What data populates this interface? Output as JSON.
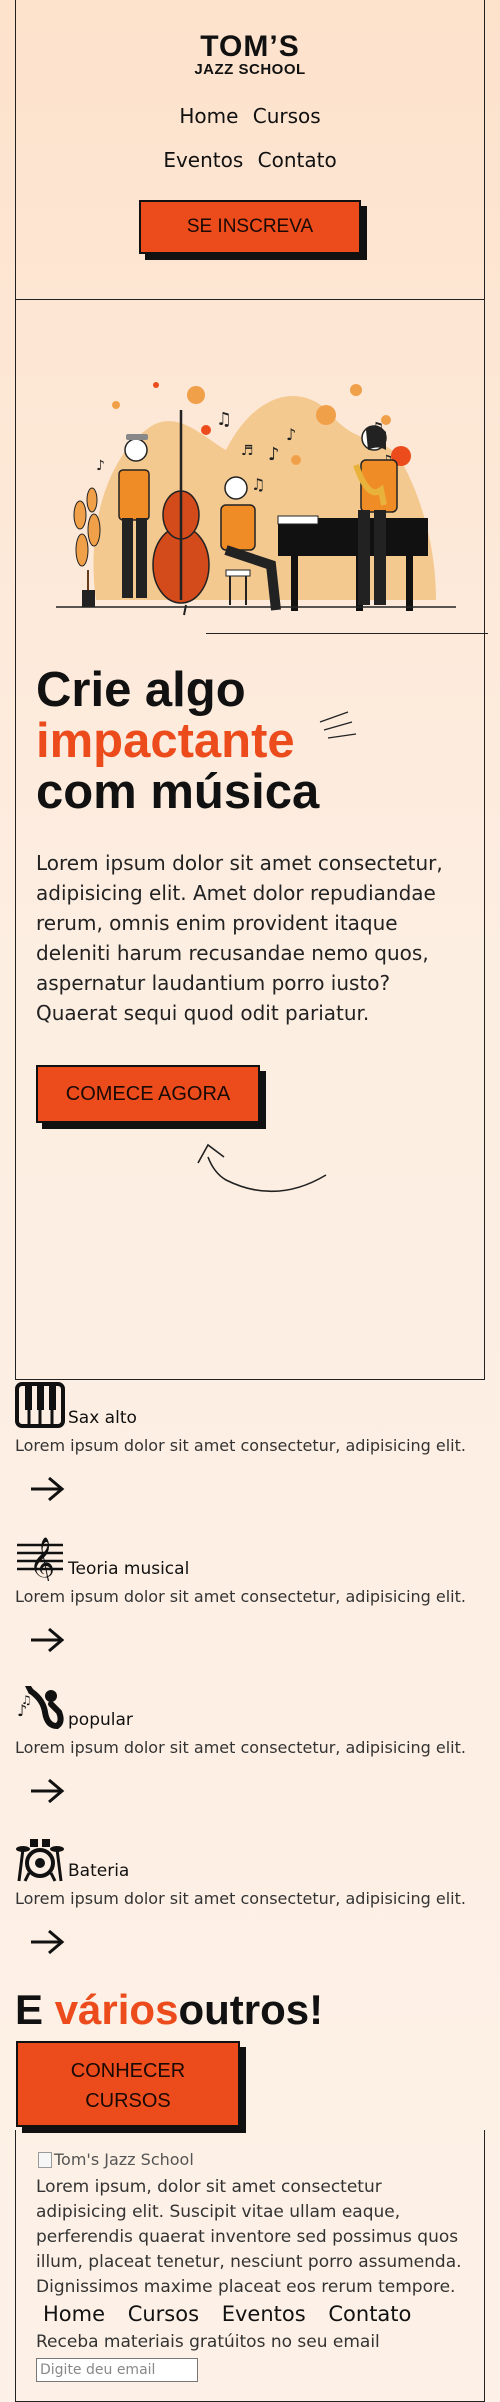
{
  "brand": {
    "name": "TOM’S",
    "sub": "JAZZ SCHOOL"
  },
  "nav": {
    "home": "Home",
    "courses": "Cursos",
    "events": "Eventos",
    "contact": "Contato"
  },
  "header": {
    "subscribe_label": "SE INSCREVA"
  },
  "hero": {
    "title_line1": "Crie algo",
    "title_accent": "impactante",
    "title_line3": "com música",
    "text": "Lorem ipsum dolor sit amet consectetur, adipisicing elit. Amet dolor repudiandae rerum, omnis enim provident itaque deleniti harum recusandae nemo quos, aspernatur laudantium porro iusto? Quaerat sequi quod odit pariatur.",
    "cta_label": "COMECE AGORA"
  },
  "features": [
    {
      "icon": "piano-keys-icon",
      "title": "Sax alto",
      "desc": "Lorem ipsum dolor sit amet consectetur, adipisicing elit."
    },
    {
      "icon": "treble-clef-icon",
      "title": "Teoria musical",
      "desc": "Lorem ipsum dolor sit amet consectetur, adipisicing elit."
    },
    {
      "icon": "saxophone-icon",
      "title": "popular",
      "desc": "Lorem ipsum dolor sit amet consectetur, adipisicing elit."
    },
    {
      "icon": "drum-kit-icon",
      "title": "Bateria",
      "desc": "Lorem ipsum dolor sit amet consectetur, adipisicing elit."
    }
  ],
  "various": {
    "prefix": "E ",
    "accent": "vários",
    "suffix": "outros!"
  },
  "courses_button": {
    "line1": "CONHECER",
    "line2": "CURSOS"
  },
  "footer": {
    "logo_alt": "Tom's Jazz School",
    "text": "Lorem ipsum, dolor sit amet consectetur adipisicing elit. Suscipit vitae ullam eaque, perferendis quaerat inventore sed possimus quos illum, placeat tenetur, nesciunt porro assumenda. Dignissimos maxime placeat eos rerum tempore.",
    "newsletter_label": "Receba materiais gratúitos no seu email",
    "email_placeholder": "Digite deu email"
  },
  "colors": {
    "accent": "#ec4b1c",
    "background": "#fde2cc",
    "ink": "#111111"
  }
}
